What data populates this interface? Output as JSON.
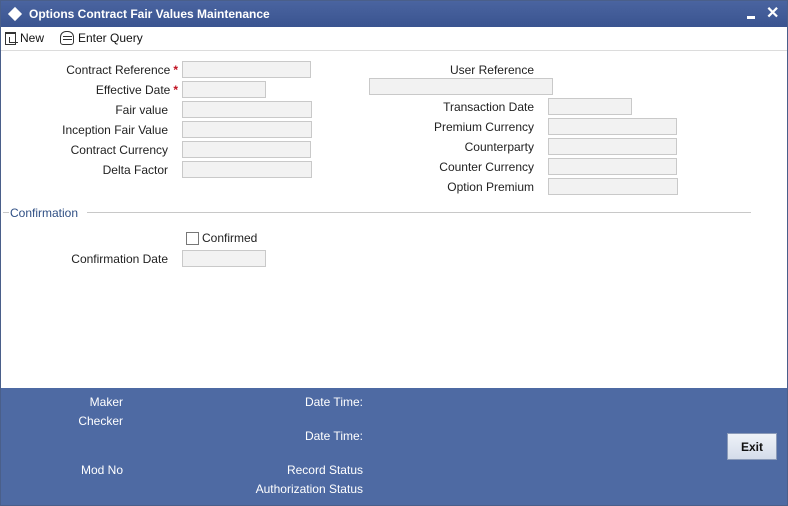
{
  "window": {
    "title": "Options Contract Fair Values Maintenance"
  },
  "toolbar": {
    "new_label": "New",
    "enter_query_label": "Enter Query"
  },
  "form": {
    "contract_reference_label": "Contract Reference",
    "effective_date_label": "Effective Date",
    "fair_value_label": "Fair value",
    "inception_fair_value_label": "Inception Fair Value",
    "contract_currency_label": "Contract Currency",
    "delta_factor_label": "Delta Factor",
    "user_reference_label": "User Reference",
    "transaction_date_label": "Transaction Date",
    "premium_currency_label": "Premium Currency",
    "counterparty_label": "Counterparty",
    "counter_currency_label": "Counter Currency",
    "option_premium_label": "Option Premium",
    "required_marker": "*",
    "values": {
      "contract_reference": "",
      "effective_date": "",
      "fair_value": "",
      "inception_fair_value": "",
      "contract_currency": "",
      "delta_factor": "",
      "user_reference": "",
      "transaction_date": "",
      "premium_currency": "",
      "counterparty": "",
      "counter_currency": "",
      "option_premium": "",
      "confirmation_date": ""
    }
  },
  "confirmation": {
    "section_title": "Confirmation",
    "confirmed_label": "Confirmed",
    "confirmed_checked": false,
    "confirmation_date_label": "Confirmation Date"
  },
  "footer": {
    "maker_label": "Maker",
    "checker_label": "Checker",
    "date_time_label_1": "Date Time:",
    "date_time_label_2": "Date Time:",
    "mod_no_label": "Mod No",
    "record_status_label": "Record Status",
    "authorization_status_label": "Authorization Status",
    "exit_label": "Exit"
  }
}
